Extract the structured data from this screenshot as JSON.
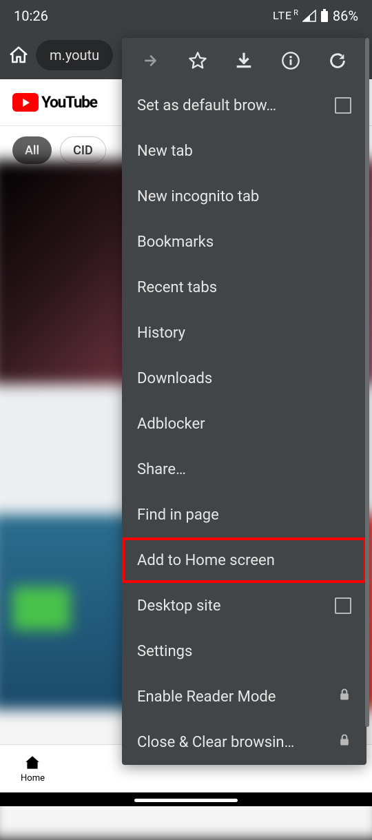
{
  "status": {
    "time": "10:26",
    "network": "LTE",
    "roaming": "R",
    "battery": "86%"
  },
  "browser": {
    "url_display": "m.youtu"
  },
  "page": {
    "logo_text": "YouTube",
    "chips": [
      {
        "label": "All",
        "active": true
      },
      {
        "label": "CID",
        "active": false
      }
    ],
    "nav_home": "Home"
  },
  "menu": {
    "set_default": "Set as default brow…",
    "new_tab": "New tab",
    "incognito": "New incognito tab",
    "bookmarks": "Bookmarks",
    "recent": "Recent tabs",
    "history": "History",
    "downloads": "Downloads",
    "adblocker": "Adblocker",
    "share": "Share…",
    "find": "Find in page",
    "add_home": "Add to Home screen",
    "desktop": "Desktop site",
    "settings": "Settings",
    "reader": "Enable Reader Mode",
    "close_clear": "Close & Clear browsin…"
  }
}
